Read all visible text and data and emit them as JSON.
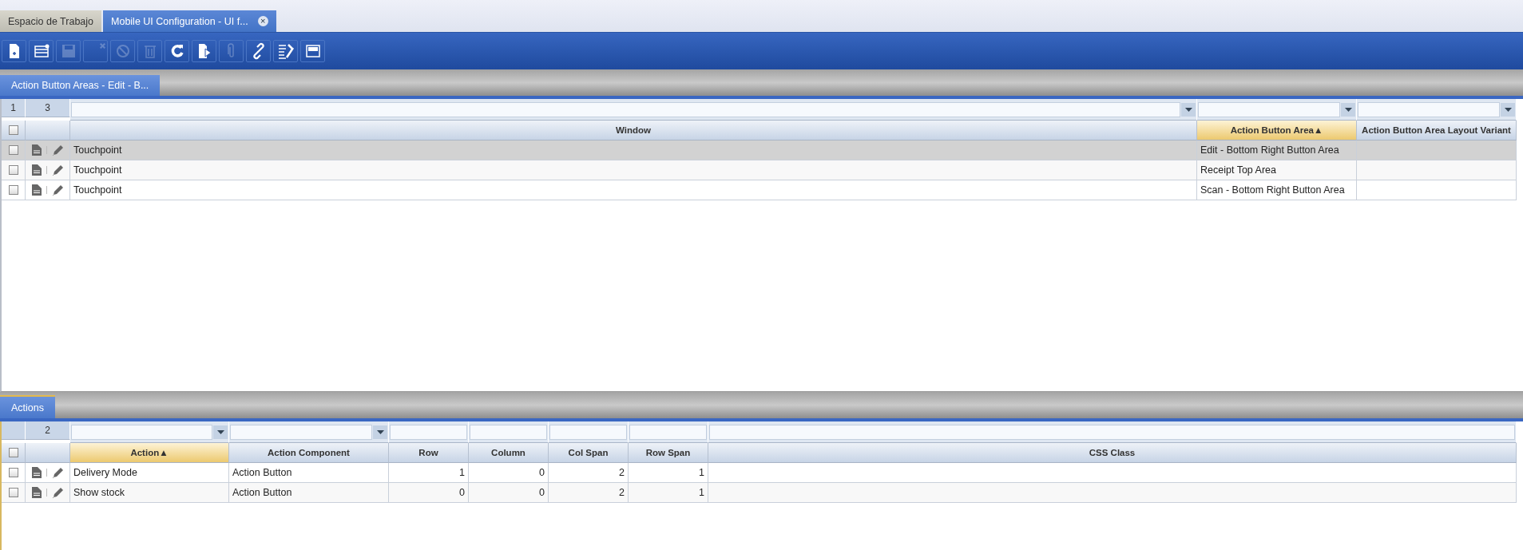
{
  "window_tabs": [
    {
      "label": "Espacio de Trabajo",
      "selected": false,
      "closable": false
    },
    {
      "label": "Mobile UI Configuration - UI f...",
      "selected": true,
      "closable": true,
      "close_glyph": "×"
    }
  ],
  "toolbar": [
    {
      "kind": "new-document",
      "disabled": false
    },
    {
      "kind": "new-row",
      "disabled": false
    },
    {
      "kind": "save",
      "disabled": true
    },
    {
      "kind": "undo",
      "disabled": true
    },
    {
      "kind": "cancel",
      "disabled": true
    },
    {
      "kind": "delete",
      "disabled": true
    },
    {
      "kind": "refresh",
      "disabled": false
    },
    {
      "kind": "export",
      "disabled": false
    },
    {
      "kind": "attach",
      "disabled": true
    },
    {
      "kind": "link",
      "disabled": false
    },
    {
      "kind": "tools",
      "disabled": false
    },
    {
      "kind": "layout",
      "disabled": false
    }
  ],
  "sections": [
    {
      "tab": {
        "label": "Action Button Areas - Edit - B...",
        "active": false
      },
      "grid": {
        "selected_count": "1",
        "row_count": "3",
        "header_checked": false,
        "columns": [
          {
            "label": "Window",
            "filter_dropdown": true,
            "kind": "text"
          },
          {
            "label": "Action Button Area",
            "filter_dropdown": true,
            "kind": "text",
            "sort_glyph": "▲"
          },
          {
            "label": "Action Button Area Layout Variant",
            "filter_dropdown": true,
            "kind": "text"
          }
        ],
        "rows": [
          {
            "selected": true,
            "checked": false,
            "cells": [
              "Touchpoint",
              "Edit - Bottom Right Button Area",
              ""
            ]
          },
          {
            "selected": false,
            "checked": false,
            "cells": [
              "Touchpoint",
              "Receipt Top Area",
              ""
            ]
          },
          {
            "selected": false,
            "checked": false,
            "cells": [
              "Touchpoint",
              "Scan - Bottom Right Button Area",
              ""
            ]
          }
        ]
      }
    },
    {
      "tab": {
        "label": "Actions",
        "active": true
      },
      "grid": {
        "row_count": "2",
        "header_checked": false,
        "columns": [
          {
            "label": "Action",
            "filter_dropdown": true,
            "kind": "text",
            "sort_glyph": "▲"
          },
          {
            "label": "Action Component",
            "filter_dropdown": true,
            "kind": "text"
          },
          {
            "label": "Row",
            "filter_dropdown": false,
            "kind": "number"
          },
          {
            "label": "Column",
            "filter_dropdown": false,
            "kind": "number"
          },
          {
            "label": "Col Span",
            "filter_dropdown": false,
            "kind": "number"
          },
          {
            "label": "Row Span",
            "filter_dropdown": false,
            "kind": "number"
          },
          {
            "label": "CSS Class",
            "filter_dropdown": false,
            "kind": "text"
          }
        ],
        "rows": [
          {
            "selected": false,
            "checked": false,
            "cells": [
              "Delivery Mode",
              "Action Button",
              "1",
              "0",
              "2",
              "1",
              ""
            ]
          },
          {
            "selected": false,
            "checked": false,
            "cells": [
              "Show stock",
              "Action Button",
              "0",
              "0",
              "2",
              "1",
              ""
            ]
          }
        ]
      }
    }
  ]
}
